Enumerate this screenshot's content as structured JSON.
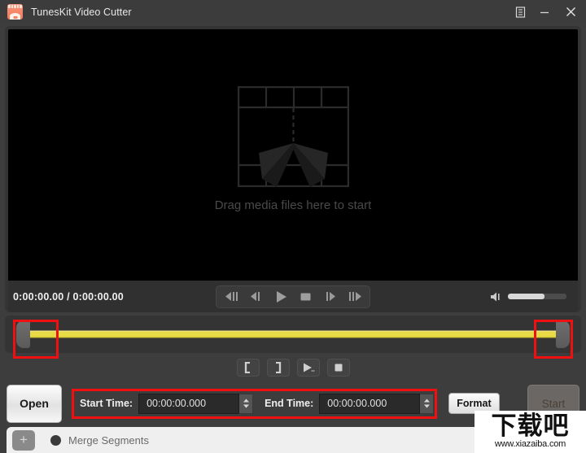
{
  "window": {
    "title": "TunesKit Video Cutter",
    "app_icon": "filmstrip-app-icon",
    "controls": {
      "menu": "menu-icon",
      "minimize": "minimize-icon",
      "close": "close-icon"
    }
  },
  "preview": {
    "drop_hint": "Drag media files here to start",
    "drop_icon": "film-frame-cut-icon",
    "background_color": "#000000"
  },
  "transport": {
    "time_display": "0:00:00.00 / 0:00:00.00",
    "buttons": [
      {
        "name": "prev-segment-button",
        "icon": "skip-back-frames-icon"
      },
      {
        "name": "prev-frame-button",
        "icon": "step-back-icon"
      },
      {
        "name": "play-button",
        "icon": "play-icon"
      },
      {
        "name": "stop-button",
        "icon": "stop-icon"
      },
      {
        "name": "next-frame-button",
        "icon": "step-forward-icon"
      },
      {
        "name": "next-segment-button",
        "icon": "skip-forward-frames-icon"
      }
    ],
    "volume": {
      "icon": "volume-icon",
      "level_percent": 62
    }
  },
  "timeline": {
    "track_color": "#e8da45",
    "left_handle": "trim-start-handle",
    "right_handle": "trim-end-handle",
    "highlight_color": "#ef1111"
  },
  "segment_tools": [
    {
      "name": "set-start-marker-button",
      "label": "["
    },
    {
      "name": "set-end-marker-button",
      "label": "]"
    },
    {
      "name": "preview-segment-button",
      "icon": "play-preview-icon"
    },
    {
      "name": "stop-preview-button",
      "icon": "stop-icon"
    }
  ],
  "actions": {
    "open_label": "Open",
    "start_time_label": "Start Time:",
    "start_time_value": "00:00:00.000",
    "end_time_label": "End Time:",
    "end_time_value": "00:00:00.000",
    "format_label": "Format",
    "start_label": "Start"
  },
  "merge": {
    "add_label": "+",
    "checkbox_state": "unchecked",
    "label": "Merge Segments"
  },
  "watermark": {
    "logo_text": "下载吧",
    "url": "www.xiazaiba.com"
  }
}
